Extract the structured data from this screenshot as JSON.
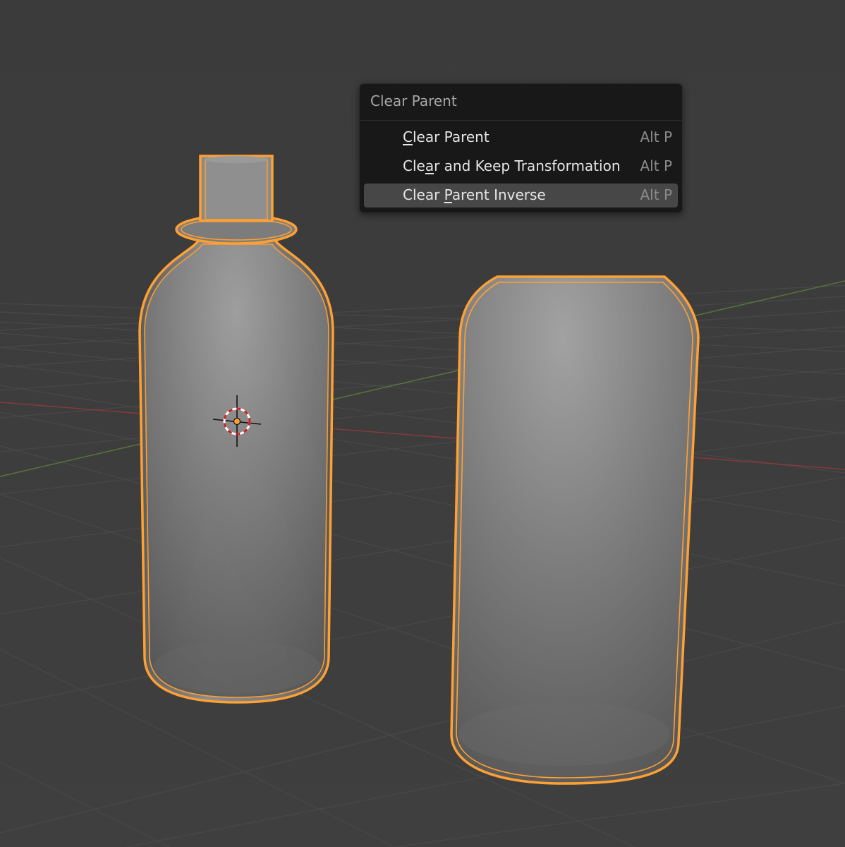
{
  "viewport": {
    "background": "#3d3d3d",
    "grid_color": "#4a4a4a",
    "x_axis_color": "#8c3a3a",
    "y_axis_color": "#5a7a3a",
    "selection_outline": "#ffa033",
    "objects": [
      "bottle",
      "can"
    ],
    "cursor_icon": "3d-cursor-icon"
  },
  "menu": {
    "title": "Clear Parent",
    "items": [
      {
        "pre": "",
        "ul": "C",
        "post": "lear Parent",
        "shortcut": "Alt P",
        "active": false
      },
      {
        "pre": "Cle",
        "ul": "a",
        "post": "r and Keep Transformation",
        "shortcut": "Alt P",
        "active": false
      },
      {
        "pre": "Clear ",
        "ul": "P",
        "post": "arent Inverse",
        "shortcut": "Alt P",
        "active": true
      }
    ]
  }
}
